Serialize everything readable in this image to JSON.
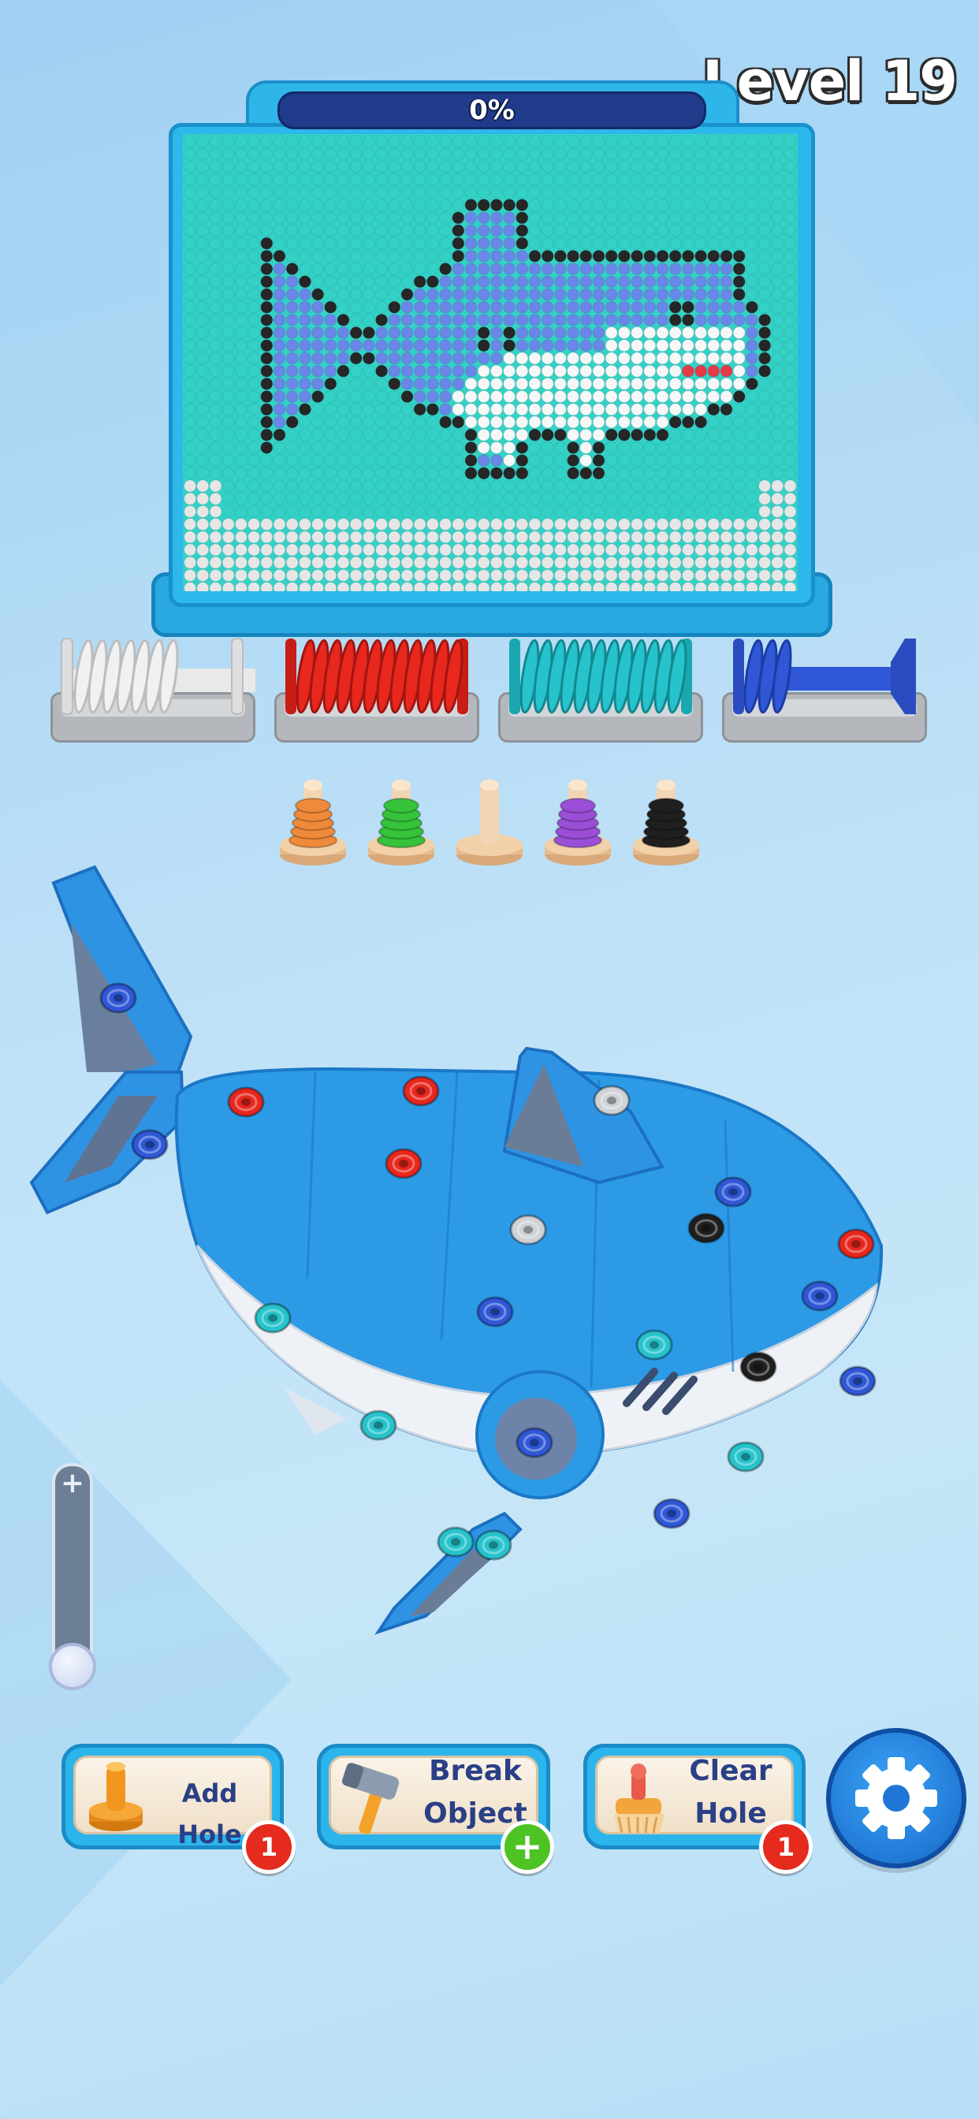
{
  "hud": {
    "level_label": "Level 19",
    "progress_text": "0%",
    "progress_fraction": 0
  },
  "board": {
    "subject": "shark"
  },
  "spools": [
    {
      "color": "#f1f1f1"
    },
    {
      "color": "#e8271e"
    },
    {
      "color": "#27c3cc"
    },
    {
      "color": "#2f57d6"
    }
  ],
  "pegs": [
    {
      "color": "#ef8a3a"
    },
    {
      "color": "#36c23a"
    },
    {
      "color": "#f2d5b3"
    },
    {
      "color": "#9a4fd6"
    },
    {
      "color": "#1f1f1f"
    }
  ],
  "model": {
    "subject": "shark"
  },
  "zoom": {
    "plus_icon": "+",
    "level_fraction": 0
  },
  "buttons": {
    "add_hole": {
      "label": "Add Hole",
      "badge": "1",
      "icon": "peg-icon"
    },
    "break_object": {
      "label_line1": "Break",
      "label_line2": "Object",
      "badge": "+",
      "icon": "hammer-icon"
    },
    "clear_hole": {
      "label_line1": "Clear",
      "label_line2": "Hole",
      "badge": "1",
      "icon": "brush-icon"
    },
    "settings": {
      "icon": "gear-icon"
    }
  }
}
